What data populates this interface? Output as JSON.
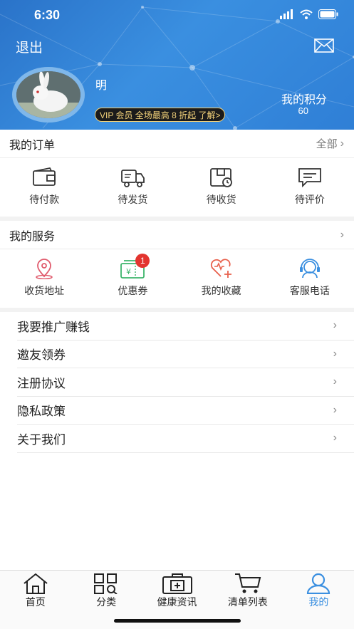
{
  "status": {
    "time": "6:30"
  },
  "header": {
    "exit_label": "退出",
    "username": "明",
    "vip_text": "VIP 会员  全场最高 8 折起  了解>",
    "points_label": "我的积分",
    "points_value": "60"
  },
  "orders": {
    "title": "我的订单",
    "all_label": "全部",
    "items": [
      {
        "label": "待付款",
        "icon": "wallet-icon"
      },
      {
        "label": "待发货",
        "icon": "truck-icon"
      },
      {
        "label": "待收货",
        "icon": "package-icon"
      },
      {
        "label": "待评价",
        "icon": "comment-icon"
      }
    ]
  },
  "services": {
    "title": "我的服务",
    "items": [
      {
        "label": "收货地址",
        "icon": "location-icon",
        "color": "#e05a6c"
      },
      {
        "label": "优惠券",
        "icon": "coupon-icon",
        "color": "#3db56b",
        "badge": "1"
      },
      {
        "label": "我的收藏",
        "icon": "heart-icon",
        "color": "#e8604c"
      },
      {
        "label": "客服电话",
        "icon": "customer-service-icon",
        "color": "#3a8fe0"
      }
    ]
  },
  "menu": [
    {
      "label": "我要推广赚钱"
    },
    {
      "label": "邀友领券"
    },
    {
      "label": "注册协议"
    },
    {
      "label": "隐私政策"
    },
    {
      "label": "关于我们"
    }
  ],
  "tabbar": {
    "items": [
      {
        "label": "首页",
        "icon": "home-icon"
      },
      {
        "label": "分类",
        "icon": "category-icon"
      },
      {
        "label": "健康资讯",
        "icon": "medical-kit-icon"
      },
      {
        "label": "清单列表",
        "icon": "cart-icon"
      },
      {
        "label": "我的",
        "icon": "profile-icon",
        "active": true
      }
    ],
    "active_color": "#3a8fe0"
  },
  "colors": {
    "header_blue": "#3a8fe0",
    "badge_red": "#e3342f",
    "vip_gold": "#f3d27a"
  }
}
